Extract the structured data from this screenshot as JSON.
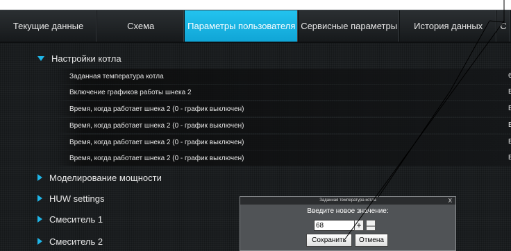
{
  "tabs": [
    {
      "label": "Текущие данные",
      "active": false
    },
    {
      "label": "Схема",
      "active": false
    },
    {
      "label": "Параметры пользователя",
      "active": true
    },
    {
      "label": "Сервисные параметры",
      "active": false
    },
    {
      "label": "История данных",
      "active": false
    },
    {
      "label": "С",
      "active": false
    }
  ],
  "boiler_section": {
    "title": "Настройки котла",
    "rows": [
      {
        "label": "Заданная температура котла",
        "value": "6"
      },
      {
        "label": "Включение графиков работы шнека 2",
        "value": "В"
      },
      {
        "label": "Время, когда работает шнека 2 (0 - график выключен)",
        "value": "В"
      },
      {
        "label": "Время, когда работает шнека 2 (0 - график выключен)",
        "value": "В"
      },
      {
        "label": "Время, когда работает шнека 2 (0 - график выключен)",
        "value": "В"
      },
      {
        "label": "Время, когда работает шнека 2 (0 - график выключен)",
        "value": "В"
      }
    ]
  },
  "collapsed_sections": [
    {
      "title": "Моделирование мощности"
    },
    {
      "title": "HUW settings"
    },
    {
      "title": "Смеситель 1"
    },
    {
      "title": "Смеситель 2"
    }
  ],
  "dialog": {
    "title": "Заданная температура котла",
    "close": "X",
    "prompt": "Введите новое значение:",
    "input_value": "68",
    "plus": "+",
    "minus": "—",
    "save_label": "Сохранить",
    "cancel_label": "Отмена"
  },
  "colors": {
    "accent": "#1fb6e8",
    "active_tab": "#18b4e6",
    "background": "#1a1d1f"
  }
}
